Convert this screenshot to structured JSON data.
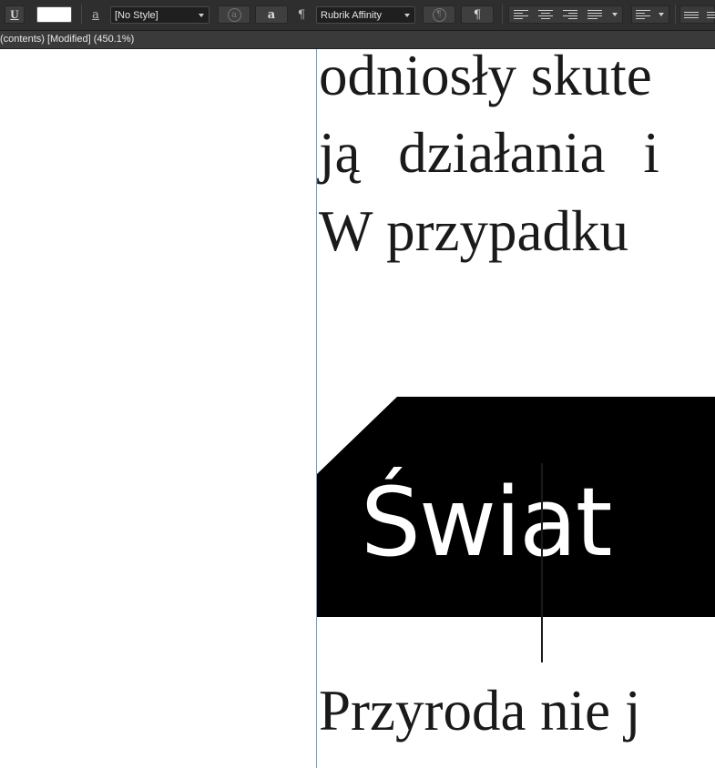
{
  "toolbar": {
    "underline_label": "U",
    "char_style_glyph": "a",
    "char_style_select": "[No Style]",
    "char_style_update_glyph": "a",
    "char_style_apply_glyph": "a",
    "paragraph_glyph": "¶",
    "para_style_select": "Rubrik Affinity",
    "para_style_update_glyph": "¶",
    "para_style_apply_glyph": "¶",
    "fill_color": "#ffffff"
  },
  "document": {
    "title": "(contents) [Modified] (450.1%)"
  },
  "canvas": {
    "body_lines": [
      "odniosły skute",
      "ją działania i",
      "W przypadku",
      "Przyroda nie j"
    ],
    "heading": "Świat"
  },
  "colors": {
    "toolbar_bg": "#2e2e2e",
    "heading_bg": "#000000",
    "guide": "#6fa3c9"
  }
}
